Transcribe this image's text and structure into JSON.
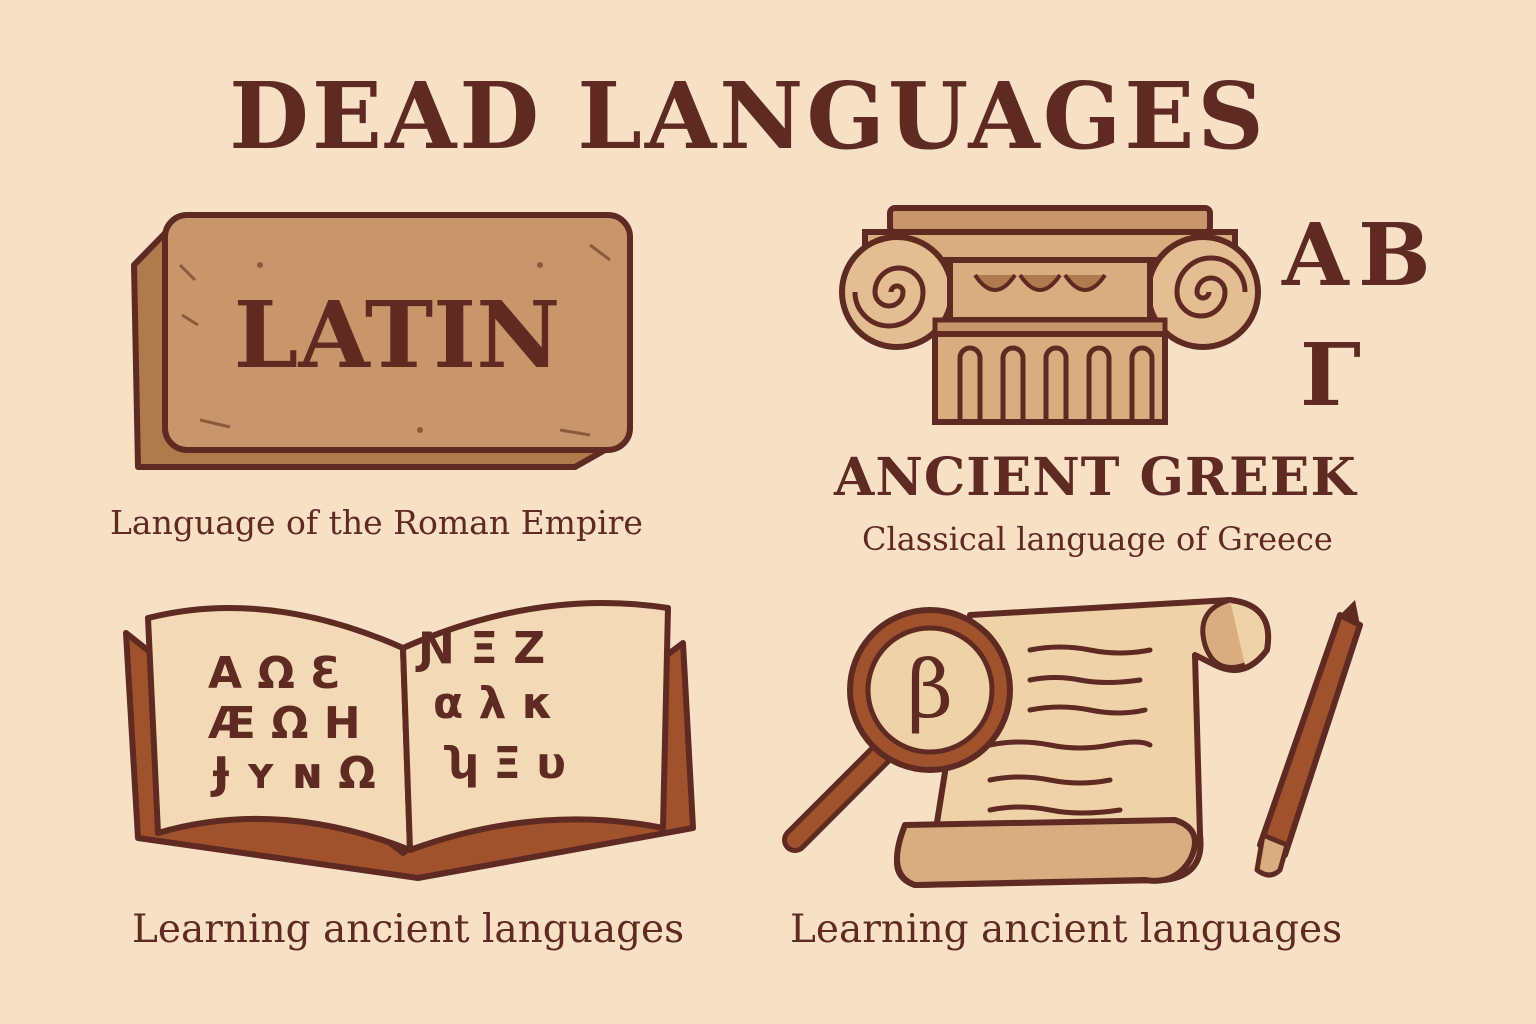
{
  "title": "DEAD LANGUAGES",
  "latin": {
    "tablet_text": "LATIN",
    "caption": "Language of the Roman Empire"
  },
  "greek": {
    "letters": [
      "Α",
      "Β",
      "Γ"
    ],
    "heading": "ANCIENT GREEK",
    "caption": "Classical language of Greece"
  },
  "book": {
    "left_page_rows": [
      "Α Ω Ɛ",
      "Æ Ω Η",
      "Ɉ ʏ ɴ Ω"
    ],
    "right_page_rows": [
      "Ɲ Ξ Ζ",
      "α λ κ",
      "ʮ Ξ υ"
    ],
    "caption": "Learning ancient languages"
  },
  "scroll": {
    "magnified_letter": "β",
    "caption": "Learning ancient languages"
  },
  "colors": {
    "background": "#f7e0c4",
    "ink": "#5e2a22",
    "stone": "#c9956a",
    "parchment": "#f3d9b5",
    "wood": "#a0522d"
  },
  "icons": [
    "stone-tablet-icon",
    "ionic-column-icon",
    "open-book-icon",
    "magnifying-glass-icon",
    "scroll-icon",
    "pencil-icon"
  ]
}
